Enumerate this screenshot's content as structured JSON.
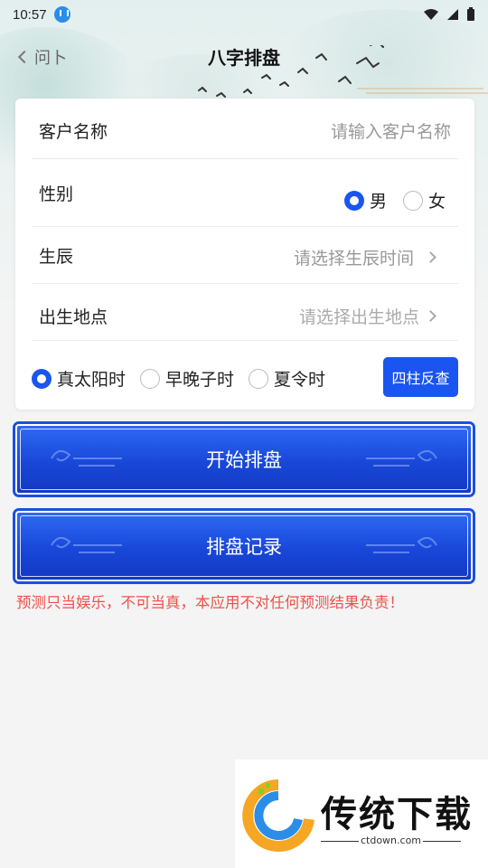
{
  "status_bar": {
    "time": "10:57"
  },
  "nav": {
    "back_label": "问卜",
    "title": "八字排盘"
  },
  "form": {
    "name": {
      "label": "客户名称",
      "placeholder": "请输入客户名称"
    },
    "gender": {
      "label": "性别",
      "options": [
        "男",
        "女"
      ],
      "selected": "男"
    },
    "birth_time": {
      "label": "生辰",
      "placeholder": "请选择生辰时间"
    },
    "birth_place": {
      "label": "出生地点",
      "placeholder": "请选择出生地点"
    },
    "time_mode": {
      "options": [
        "真太阳时",
        "早晚子时",
        "夏令时"
      ],
      "selected": "真太阳时"
    },
    "sizhu_button": "四柱反查"
  },
  "actions": {
    "start_label": "开始排盘",
    "records_label": "排盘记录"
  },
  "disclaimer": "预测只当娱乐，不可当真，本应用不对任何预测结果负责！",
  "watermark": {
    "brand": "传统下载",
    "url": "ctdown.com"
  },
  "colors": {
    "primary": "#1a55f0",
    "warning": "#f0504a"
  }
}
